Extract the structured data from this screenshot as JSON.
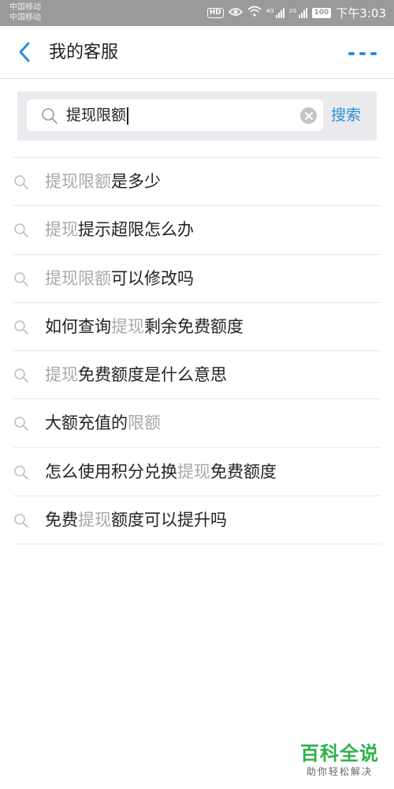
{
  "status_bar": {
    "carrier_1": "中国移动",
    "carrier_2": "中国移动",
    "hd_badge": "HD",
    "signal_1_label": "4G",
    "signal_2_label": "2G",
    "battery": "100",
    "time": "下午3:03"
  },
  "header": {
    "title": "我的客服",
    "back_icon": "chevron-left-icon",
    "more_icon": "more-dots-icon"
  },
  "search": {
    "query": "提现限额",
    "button_label": "搜索"
  },
  "suggestions": [
    {
      "parts": [
        {
          "text": "提现限额",
          "hl": true
        },
        {
          "text": "是多少",
          "hl": false
        }
      ]
    },
    {
      "parts": [
        {
          "text": "提现",
          "hl": true
        },
        {
          "text": "提示超限怎么办",
          "hl": false
        }
      ]
    },
    {
      "parts": [
        {
          "text": "提现限额",
          "hl": true
        },
        {
          "text": "可以修改吗",
          "hl": false
        }
      ]
    },
    {
      "parts": [
        {
          "text": "如何查询",
          "hl": false
        },
        {
          "text": "提现",
          "hl": true
        },
        {
          "text": "剩余免费额度",
          "hl": false
        }
      ]
    },
    {
      "parts": [
        {
          "text": "提现",
          "hl": true
        },
        {
          "text": "免费额度是什么意思",
          "hl": false
        }
      ]
    },
    {
      "parts": [
        {
          "text": "大额充值的",
          "hl": false
        },
        {
          "text": "限额",
          "hl": true
        }
      ]
    },
    {
      "parts": [
        {
          "text": "怎么使用积分兑换",
          "hl": false
        },
        {
          "text": "提现",
          "hl": true
        },
        {
          "text": "免费额度",
          "hl": false
        }
      ]
    },
    {
      "parts": [
        {
          "text": "免费",
          "hl": false
        },
        {
          "text": "提现",
          "hl": true
        },
        {
          "text": "额度可以提升吗",
          "hl": false
        }
      ]
    }
  ],
  "watermark": {
    "main": "百科全说",
    "sub": "助你轻松解决"
  },
  "colors": {
    "accent": "#2e8fd6",
    "highlight_text": "#a8a8a8",
    "watermark_green": "#2eb14a"
  }
}
